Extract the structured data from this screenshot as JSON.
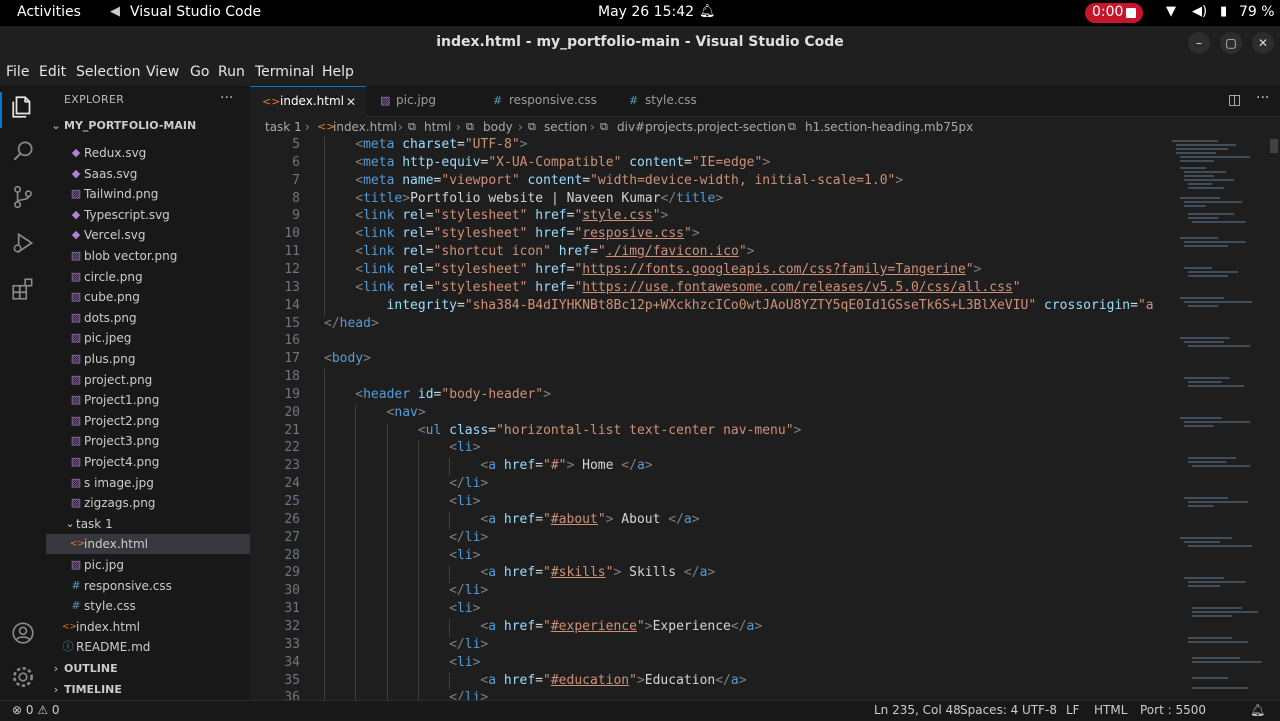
{
  "topbar": {
    "activities": "Activities",
    "app_name": "Visual Studio Code",
    "clock": "May 26  15:42",
    "recording_time": "0:00",
    "battery": "79 %"
  },
  "window": {
    "title": "index.html - my_portfolio-main - Visual Studio Code"
  },
  "menu": [
    "File",
    "Edit",
    "Selection",
    "View",
    "Go",
    "Run",
    "Terminal",
    "Help"
  ],
  "sidebar": {
    "header": "EXPLORER",
    "root": "MY_PORTFOLIO-MAIN",
    "items": [
      {
        "label": "Redux.svg",
        "icon": "svg"
      },
      {
        "label": "Saas.svg",
        "icon": "svg"
      },
      {
        "label": "Tailwind.png",
        "icon": "img"
      },
      {
        "label": "Typescript.svg",
        "icon": "svg"
      },
      {
        "label": "Vercel.svg",
        "icon": "svg"
      },
      {
        "label": "blob vector.png",
        "icon": "img"
      },
      {
        "label": "circle.png",
        "icon": "img"
      },
      {
        "label": "cube.png",
        "icon": "img"
      },
      {
        "label": "dots.png",
        "icon": "img"
      },
      {
        "label": "pic.jpeg",
        "icon": "img"
      },
      {
        "label": "plus.png",
        "icon": "img"
      },
      {
        "label": "project.png",
        "icon": "img"
      },
      {
        "label": "Project1.png",
        "icon": "img"
      },
      {
        "label": "Project2.png",
        "icon": "img"
      },
      {
        "label": "Project3.png",
        "icon": "img"
      },
      {
        "label": "Project4.png",
        "icon": "img"
      },
      {
        "label": "s image.jpg",
        "icon": "img"
      },
      {
        "label": "zigzags.png",
        "icon": "img"
      },
      {
        "label": "task 1",
        "icon": "folder"
      },
      {
        "label": "index.html",
        "icon": "html"
      },
      {
        "label": "pic.jpg",
        "icon": "img"
      },
      {
        "label": "responsive.css",
        "icon": "css"
      },
      {
        "label": "style.css",
        "icon": "css"
      },
      {
        "label": "index.html",
        "icon": "html"
      },
      {
        "label": "README.md",
        "icon": "md"
      }
    ],
    "outline": "OUTLINE",
    "timeline": "TIMELINE"
  },
  "tabs": [
    {
      "label": "index.html",
      "icon": "<>"
    },
    {
      "label": "pic.jpg",
      "icon": "▨"
    },
    {
      "label": "responsive.css",
      "icon": "#"
    },
    {
      "label": "style.css",
      "icon": "#"
    }
  ],
  "breadcrumb": [
    "task 1",
    "index.html",
    "html",
    "body",
    "section",
    "div#projects.project-section",
    "h1.section-heading.mb75px"
  ],
  "code": [
    {
      "n": "5",
      "indent": 1,
      "t": [
        [
          "pu",
          "<"
        ],
        [
          "tg",
          "meta"
        ],
        [
          "tx",
          " "
        ],
        [
          "at",
          "charset"
        ],
        [
          "tx",
          "="
        ],
        [
          "st",
          "\"UTF-8\""
        ],
        [
          "pu",
          ">"
        ]
      ]
    },
    {
      "n": "6",
      "indent": 1,
      "t": [
        [
          "pu",
          "<"
        ],
        [
          "tg",
          "meta"
        ],
        [
          "tx",
          " "
        ],
        [
          "at",
          "http-equiv"
        ],
        [
          "tx",
          "="
        ],
        [
          "st",
          "\"X-UA-Compatible\""
        ],
        [
          "tx",
          " "
        ],
        [
          "at",
          "content"
        ],
        [
          "tx",
          "="
        ],
        [
          "st",
          "\"IE=edge\""
        ],
        [
          "pu",
          ">"
        ]
      ]
    },
    {
      "n": "7",
      "indent": 1,
      "t": [
        [
          "pu",
          "<"
        ],
        [
          "tg",
          "meta"
        ],
        [
          "tx",
          " "
        ],
        [
          "at",
          "name"
        ],
        [
          "tx",
          "="
        ],
        [
          "st",
          "\"viewport\""
        ],
        [
          "tx",
          " "
        ],
        [
          "at",
          "content"
        ],
        [
          "tx",
          "="
        ],
        [
          "st",
          "\"width=device-width, initial-scale=1.0\""
        ],
        [
          "pu",
          ">"
        ]
      ]
    },
    {
      "n": "8",
      "indent": 1,
      "t": [
        [
          "pu",
          "<"
        ],
        [
          "tg",
          "title"
        ],
        [
          "pu",
          ">"
        ],
        [
          "tx",
          "Portfolio website | Naveen Kumar"
        ],
        [
          "pu",
          "</"
        ],
        [
          "tg",
          "title"
        ],
        [
          "pu",
          ">"
        ]
      ]
    },
    {
      "n": "9",
      "indent": 1,
      "t": [
        [
          "pu",
          "<"
        ],
        [
          "tg",
          "link"
        ],
        [
          "tx",
          " "
        ],
        [
          "at",
          "rel"
        ],
        [
          "tx",
          "="
        ],
        [
          "st",
          "\"stylesheet\""
        ],
        [
          "tx",
          " "
        ],
        [
          "at",
          "href"
        ],
        [
          "tx",
          "="
        ],
        [
          "st",
          "\""
        ],
        [
          "stu",
          "style.css"
        ],
        [
          "st",
          "\""
        ],
        [
          "pu",
          ">"
        ]
      ]
    },
    {
      "n": "10",
      "indent": 1,
      "t": [
        [
          "pu",
          "<"
        ],
        [
          "tg",
          "link"
        ],
        [
          "tx",
          " "
        ],
        [
          "at",
          "rel"
        ],
        [
          "tx",
          "="
        ],
        [
          "st",
          "\"stylesheet\""
        ],
        [
          "tx",
          " "
        ],
        [
          "at",
          "href"
        ],
        [
          "tx",
          "="
        ],
        [
          "st",
          "\""
        ],
        [
          "stu",
          "resposive.css"
        ],
        [
          "st",
          "\""
        ],
        [
          "pu",
          ">"
        ]
      ]
    },
    {
      "n": "11",
      "indent": 1,
      "t": [
        [
          "pu",
          "<"
        ],
        [
          "tg",
          "link"
        ],
        [
          "tx",
          " "
        ],
        [
          "at",
          "rel"
        ],
        [
          "tx",
          "="
        ],
        [
          "st",
          "\"shortcut icon\""
        ],
        [
          "tx",
          " "
        ],
        [
          "at",
          "href"
        ],
        [
          "tx",
          "="
        ],
        [
          "st",
          "\""
        ],
        [
          "stu",
          "./img/favicon.ico"
        ],
        [
          "st",
          "\""
        ],
        [
          "pu",
          ">"
        ]
      ]
    },
    {
      "n": "12",
      "indent": 1,
      "t": [
        [
          "pu",
          "<"
        ],
        [
          "tg",
          "link"
        ],
        [
          "tx",
          " "
        ],
        [
          "at",
          "rel"
        ],
        [
          "tx",
          "="
        ],
        [
          "st",
          "\"stylesheet\""
        ],
        [
          "tx",
          " "
        ],
        [
          "at",
          "href"
        ],
        [
          "tx",
          "="
        ],
        [
          "st",
          "\""
        ],
        [
          "stu",
          "https://fonts.googleapis.com/css?family=Tangerine"
        ],
        [
          "st",
          "\""
        ],
        [
          "pu",
          ">"
        ]
      ]
    },
    {
      "n": "13",
      "indent": 1,
      "t": [
        [
          "pu",
          "<"
        ],
        [
          "tg",
          "link"
        ],
        [
          "tx",
          " "
        ],
        [
          "at",
          "rel"
        ],
        [
          "tx",
          "="
        ],
        [
          "st",
          "\"stylesheet\""
        ],
        [
          "tx",
          " "
        ],
        [
          "at",
          "href"
        ],
        [
          "tx",
          "="
        ],
        [
          "st",
          "\""
        ],
        [
          "stu",
          "https://use.fontawesome.com/releases/v5.5.0/css/all.css"
        ],
        [
          "st",
          "\""
        ]
      ]
    },
    {
      "n": "14",
      "indent": 2,
      "t": [
        [
          "at",
          "integrity"
        ],
        [
          "tx",
          "="
        ],
        [
          "st",
          "\"sha384-B4dIYHKNBt8Bc12p+WXckhzcICo0wtJAoU8YZTY5qE0Id1GSseTk6S+L3BlXeVIU\""
        ],
        [
          "tx",
          " "
        ],
        [
          "at",
          "crossorigin"
        ],
        [
          "tx",
          "="
        ],
        [
          "st",
          "\"a"
        ]
      ]
    },
    {
      "n": "15",
      "indent": 0,
      "t": [
        [
          "pu",
          "</"
        ],
        [
          "tg",
          "head"
        ],
        [
          "pu",
          ">"
        ]
      ]
    },
    {
      "n": "16",
      "indent": 0,
      "t": []
    },
    {
      "n": "17",
      "indent": 0,
      "t": [
        [
          "pu",
          "<"
        ],
        [
          "tg",
          "body"
        ],
        [
          "pu",
          ">"
        ]
      ]
    },
    {
      "n": "18",
      "indent": 0,
      "t": []
    },
    {
      "n": "19",
      "indent": 1,
      "t": [
        [
          "pu",
          "<"
        ],
        [
          "tg",
          "header"
        ],
        [
          "tx",
          " "
        ],
        [
          "at",
          "id"
        ],
        [
          "tx",
          "="
        ],
        [
          "st",
          "\"body-header\""
        ],
        [
          "pu",
          ">"
        ]
      ]
    },
    {
      "n": "20",
      "indent": 2,
      "t": [
        [
          "pu",
          "<"
        ],
        [
          "tg",
          "nav"
        ],
        [
          "pu",
          ">"
        ]
      ]
    },
    {
      "n": "21",
      "indent": 3,
      "t": [
        [
          "pu",
          "<"
        ],
        [
          "tg",
          "ul"
        ],
        [
          "tx",
          " "
        ],
        [
          "at",
          "class"
        ],
        [
          "tx",
          "="
        ],
        [
          "st",
          "\"horizontal-list text-center nav-menu\""
        ],
        [
          "pu",
          ">"
        ]
      ]
    },
    {
      "n": "22",
      "indent": 4,
      "t": [
        [
          "pu",
          "<"
        ],
        [
          "tg",
          "li"
        ],
        [
          "pu",
          ">"
        ]
      ]
    },
    {
      "n": "23",
      "indent": 5,
      "t": [
        [
          "pu",
          "<"
        ],
        [
          "tg",
          "a"
        ],
        [
          "tx",
          " "
        ],
        [
          "at",
          "href"
        ],
        [
          "tx",
          "="
        ],
        [
          "st",
          "\"#\""
        ],
        [
          "pu",
          ">"
        ],
        [
          "tx",
          " Home "
        ],
        [
          "pu",
          "</"
        ],
        [
          "tg",
          "a"
        ],
        [
          "pu",
          ">"
        ]
      ]
    },
    {
      "n": "24",
      "indent": 4,
      "t": [
        [
          "pu",
          "</"
        ],
        [
          "tg",
          "li"
        ],
        [
          "pu",
          ">"
        ]
      ]
    },
    {
      "n": "25",
      "indent": 4,
      "t": [
        [
          "pu",
          "<"
        ],
        [
          "tg",
          "li"
        ],
        [
          "pu",
          ">"
        ]
      ]
    },
    {
      "n": "26",
      "indent": 5,
      "t": [
        [
          "pu",
          "<"
        ],
        [
          "tg",
          "a"
        ],
        [
          "tx",
          " "
        ],
        [
          "at",
          "href"
        ],
        [
          "tx",
          "="
        ],
        [
          "st",
          "\""
        ],
        [
          "stu",
          "#about"
        ],
        [
          "st",
          "\""
        ],
        [
          "pu",
          ">"
        ],
        [
          "tx",
          " About "
        ],
        [
          "pu",
          "</"
        ],
        [
          "tg",
          "a"
        ],
        [
          "pu",
          ">"
        ]
      ]
    },
    {
      "n": "27",
      "indent": 4,
      "t": [
        [
          "pu",
          "</"
        ],
        [
          "tg",
          "li"
        ],
        [
          "pu",
          ">"
        ]
      ]
    },
    {
      "n": "28",
      "indent": 4,
      "t": [
        [
          "pu",
          "<"
        ],
        [
          "tg",
          "li"
        ],
        [
          "pu",
          ">"
        ]
      ]
    },
    {
      "n": "29",
      "indent": 5,
      "t": [
        [
          "pu",
          "<"
        ],
        [
          "tg",
          "a"
        ],
        [
          "tx",
          " "
        ],
        [
          "at",
          "href"
        ],
        [
          "tx",
          "="
        ],
        [
          "st",
          "\""
        ],
        [
          "stu",
          "#skills"
        ],
        [
          "st",
          "\""
        ],
        [
          "pu",
          ">"
        ],
        [
          "tx",
          " Skills "
        ],
        [
          "pu",
          "</"
        ],
        [
          "tg",
          "a"
        ],
        [
          "pu",
          ">"
        ]
      ]
    },
    {
      "n": "30",
      "indent": 4,
      "t": [
        [
          "pu",
          "</"
        ],
        [
          "tg",
          "li"
        ],
        [
          "pu",
          ">"
        ]
      ]
    },
    {
      "n": "31",
      "indent": 4,
      "t": [
        [
          "pu",
          "<"
        ],
        [
          "tg",
          "li"
        ],
        [
          "pu",
          ">"
        ]
      ]
    },
    {
      "n": "32",
      "indent": 5,
      "t": [
        [
          "pu",
          "<"
        ],
        [
          "tg",
          "a"
        ],
        [
          "tx",
          " "
        ],
        [
          "at",
          "href"
        ],
        [
          "tx",
          "="
        ],
        [
          "st",
          "\""
        ],
        [
          "stu",
          "#experience"
        ],
        [
          "st",
          "\""
        ],
        [
          "pu",
          ">"
        ],
        [
          "tx",
          "Experience"
        ],
        [
          "pu",
          "</"
        ],
        [
          "tg",
          "a"
        ],
        [
          "pu",
          ">"
        ]
      ]
    },
    {
      "n": "33",
      "indent": 4,
      "t": [
        [
          "pu",
          "</"
        ],
        [
          "tg",
          "li"
        ],
        [
          "pu",
          ">"
        ]
      ]
    },
    {
      "n": "34",
      "indent": 4,
      "t": [
        [
          "pu",
          "<"
        ],
        [
          "tg",
          "li"
        ],
        [
          "pu",
          ">"
        ]
      ]
    },
    {
      "n": "35",
      "indent": 5,
      "t": [
        [
          "pu",
          "<"
        ],
        [
          "tg",
          "a"
        ],
        [
          "tx",
          " "
        ],
        [
          "at",
          "href"
        ],
        [
          "tx",
          "="
        ],
        [
          "st",
          "\""
        ],
        [
          "stu",
          "#education"
        ],
        [
          "st",
          "\""
        ],
        [
          "pu",
          ">"
        ],
        [
          "tx",
          "Education"
        ],
        [
          "pu",
          "</"
        ],
        [
          "tg",
          "a"
        ],
        [
          "pu",
          ">"
        ]
      ]
    },
    {
      "n": "36",
      "indent": 4,
      "t": [
        [
          "pu",
          "</"
        ],
        [
          "tg",
          "li"
        ],
        [
          "pu",
          ">"
        ]
      ]
    }
  ],
  "status": {
    "problems": "⊗ 0 ⚠ 0",
    "position": "Ln 235, Col 48",
    "spaces": "Spaces: 4",
    "encoding": "UTF-8",
    "eol": "LF",
    "language": "HTML",
    "port": "Port : 5500"
  },
  "colors": {
    "accent": "#0078d4",
    "record": "#c7162b",
    "tag": "#569cd6",
    "attr": "#9cdcfe",
    "string": "#ce9178"
  }
}
